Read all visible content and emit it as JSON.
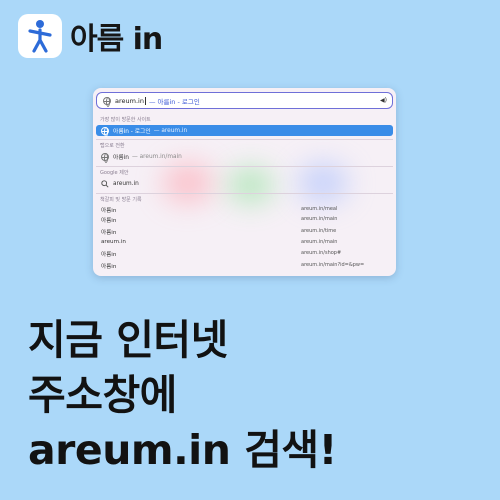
{
  "brand": {
    "name": "아름 in"
  },
  "browser": {
    "address": {
      "typed": "areum.in",
      "suggestion": "— 아름in - 로그인"
    },
    "sections": {
      "top_sites_label": "가장 많이 방문한 사이트",
      "switch_tab_label": "탭으로 전환",
      "google_label": "Google 제안",
      "history_label": "책갈피 및 방문 기록"
    },
    "top_site": {
      "title": "아름in - 로그인",
      "url": "— areum.in"
    },
    "switch_tab": {
      "title": "아름in",
      "url": "— areum.in/main"
    },
    "google_suggestion": "areum.in",
    "history": [
      {
        "title": "아름in",
        "url": "areum.in/meal"
      },
      {
        "title": "아름in",
        "url": "areum.in/main"
      },
      {
        "title": "아름in",
        "url": "areum.in/time"
      },
      {
        "title": "areum.in",
        "url": "areum.in/main"
      },
      {
        "title": "아름in",
        "url": "areum.in/shop#"
      },
      {
        "title": "아름in",
        "url": "areum.in/main?id=&pw="
      }
    ]
  },
  "headline": {
    "line1": "지금 인터넷",
    "line2": "주소창에",
    "line3": "areum.in 검색!"
  },
  "colors": {
    "background": "#abd8f9",
    "selected": "#3a8de8",
    "logo_icon": "#2d6bd8"
  }
}
